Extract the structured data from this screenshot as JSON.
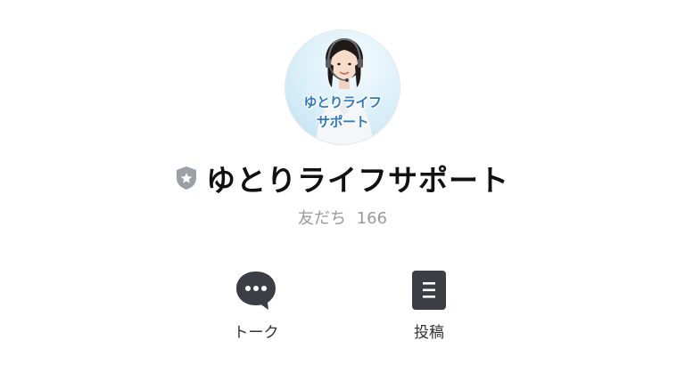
{
  "profile": {
    "avatar_caption_line1": "ゆとりライフ",
    "avatar_caption_line2": "サポート",
    "badge_icon": "shield-star-icon",
    "account_name": "ゆとりライフサポート",
    "friends_label": "友だち",
    "friends_count": "166"
  },
  "actions": [
    {
      "label": "トーク",
      "icon": "speech-bubble-icon"
    },
    {
      "label": "投稿",
      "icon": "document-icon"
    }
  ],
  "colors": {
    "icon_dark": "#3b3f45",
    "badge_gray": "#9aa0a6",
    "caption_blue": "#2e7bc4"
  }
}
